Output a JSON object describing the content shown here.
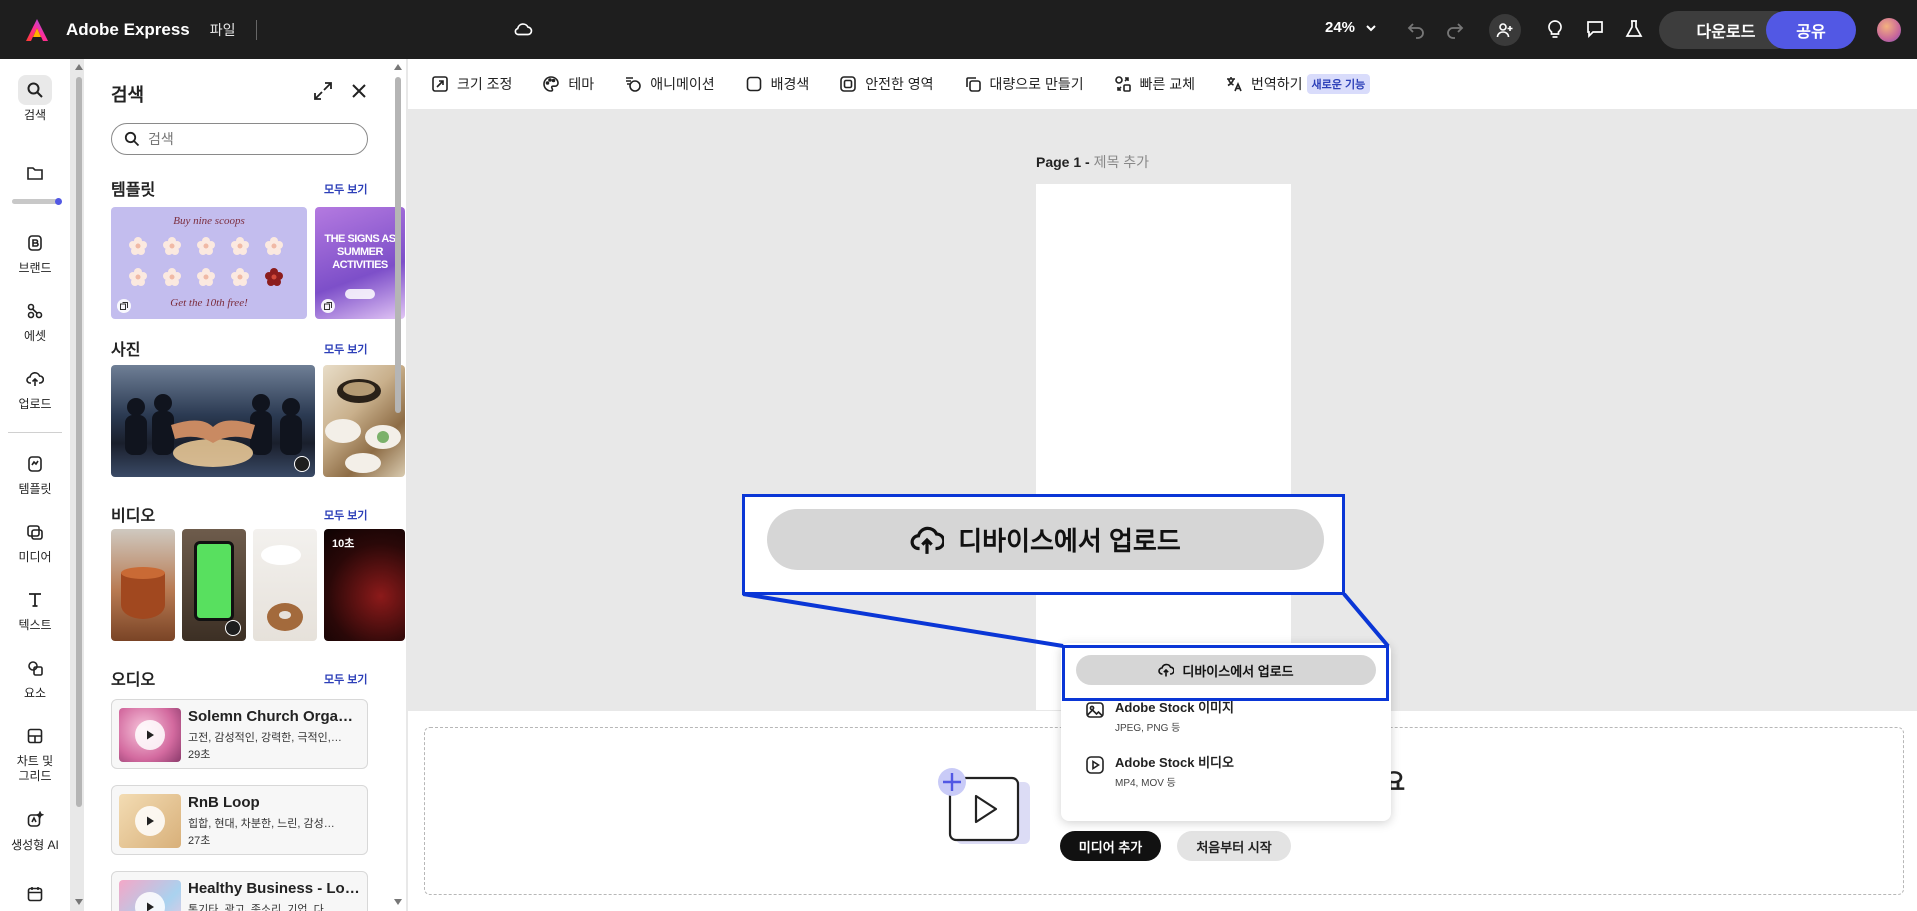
{
  "topbar": {
    "app_title": "Adobe Express",
    "file_menu": "파일",
    "zoom": "24%",
    "download_label": "다운로드",
    "share_label": "공유"
  },
  "rail": {
    "items": [
      {
        "label": "검색",
        "icon": "search-icon"
      },
      {
        "label": "",
        "icon": "folder-icon"
      },
      {
        "label": "브랜드",
        "icon": "brand-icon"
      },
      {
        "label": "에셋",
        "icon": "assets-icon"
      },
      {
        "label": "업로드",
        "icon": "upload-icon"
      },
      {
        "label": "템플릿",
        "icon": "template-icon"
      },
      {
        "label": "미디어",
        "icon": "media-icon"
      },
      {
        "label": "텍스트",
        "icon": "text-icon"
      },
      {
        "label": "요소",
        "icon": "elements-icon"
      },
      {
        "label": "차트 및 그리드",
        "icon": "chart-grid-icon"
      },
      {
        "label": "생성형 AI",
        "icon": "generative-ai-icon"
      }
    ]
  },
  "panel": {
    "title": "검색",
    "search_placeholder": "검색",
    "see_all": "모두 보기",
    "sections": {
      "templates": "템플릿",
      "photos": "사진",
      "videos": "비디오",
      "audio": "오디오"
    },
    "template1": {
      "top_text": "Buy nine scoops",
      "bottom_text": "Get the 10th free!"
    },
    "template2": {
      "text": "THE SIGNS AS SUMMER ACTIVITIES"
    },
    "video_badge": "10초",
    "audio_items": [
      {
        "title": "Solemn Church Organ…",
        "tags": "고전, 감성적인, 강력한, 극적인,…",
        "duration": "29초"
      },
      {
        "title": "RnB Loop",
        "tags": "힙합, 현대, 차분한, 느린, 감성…",
        "duration": "27초"
      },
      {
        "title": "Healthy Business - Loop",
        "tags": "통기타, 광고, 종소리, 기업, 다…",
        "duration": ""
      }
    ]
  },
  "toolbar": {
    "items": [
      {
        "label": "크기 조정",
        "icon": "resize-icon"
      },
      {
        "label": "테마",
        "icon": "theme-icon"
      },
      {
        "label": "애니메이션",
        "icon": "animation-icon"
      },
      {
        "label": "배경색",
        "icon": "background-color-icon"
      },
      {
        "label": "안전한 영역",
        "icon": "safe-zone-icon"
      },
      {
        "label": "대량으로 만들기",
        "icon": "bulk-create-icon"
      },
      {
        "label": "빠른 교체",
        "icon": "quick-swap-icon"
      },
      {
        "label": "번역하기",
        "icon": "translate-icon"
      }
    ],
    "new_badge": "새로운 기능"
  },
  "canvas": {
    "page_label": "Page 1 -",
    "page_title_placeholder": "제목 추가"
  },
  "dropdown": {
    "upload_label": "디바이스에서 업로드",
    "stock_image_title": "Adobe Stock 이미지",
    "stock_image_sub": "JPEG, PNG 등",
    "stock_video_title": "Adobe Stock 비디오",
    "stock_video_sub": "MP4, MOV 등"
  },
  "bottom": {
    "add_media_label": "미디어 추가",
    "start_over_label": "처음부터 시작",
    "peek_text": "요"
  },
  "callout": {
    "upload_label": "디바이스에서 업로드"
  },
  "colors": {
    "accent": "#5258e4",
    "highlight": "#0a36d6",
    "topbar": "#1e1e1e"
  }
}
